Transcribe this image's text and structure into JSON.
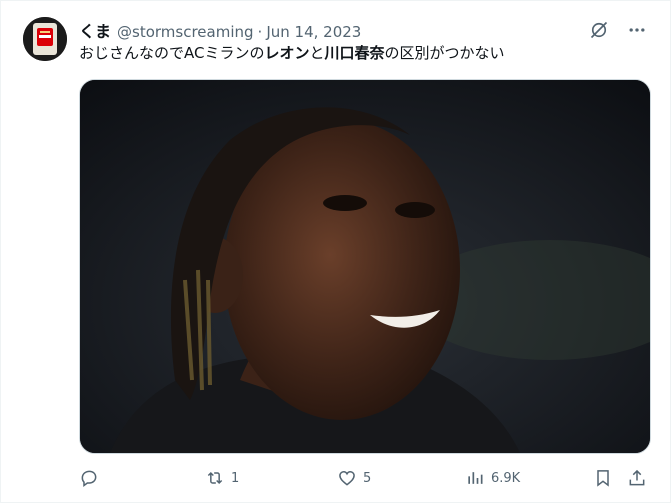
{
  "tweet": {
    "display_name": "くま",
    "handle": "@stormscreaming",
    "separator": "·",
    "date": "Jun 14, 2023",
    "text_parts": [
      "おじさんなのでACミランの",
      "レオン",
      "と",
      "川口春奈",
      "の区別がつかない"
    ]
  },
  "actions": {
    "reply_count": "",
    "retweet_count": "1",
    "like_count": "5",
    "views_count": "6.9K"
  },
  "icons": {
    "avatar": "arsenal-badge-avatar",
    "grok": "grok-icon",
    "more": "more-icon",
    "reply": "reply-icon",
    "retweet": "retweet-icon",
    "like": "heart-icon",
    "views": "views-icon",
    "bookmark": "bookmark-icon",
    "share": "share-icon"
  },
  "colors": {
    "text": "#0f1419",
    "secondary": "#536471",
    "badge_red": "#db0007"
  }
}
